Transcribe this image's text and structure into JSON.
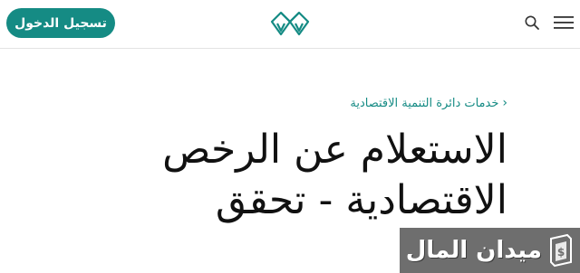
{
  "header": {
    "login_label": "تسجيل الدخول",
    "logo_icon": "site-logo-icon",
    "search_icon": "search-icon",
    "menu_icon": "hamburger-menu-icon"
  },
  "breadcrumb": {
    "chevron_icon": "chevron-left-icon",
    "label": "خدمات دائرة التنمية الاقتصادية"
  },
  "page": {
    "title": "الاستعلام عن الرخص الاقتصادية - تحقق"
  },
  "watermark": {
    "logo_icon": "watermark-logo-icon"
  },
  "colors": {
    "accent": "#158b84",
    "text": "#111111",
    "divider": "#e3e3e3",
    "watermark_bg": "#6e6e6e"
  }
}
